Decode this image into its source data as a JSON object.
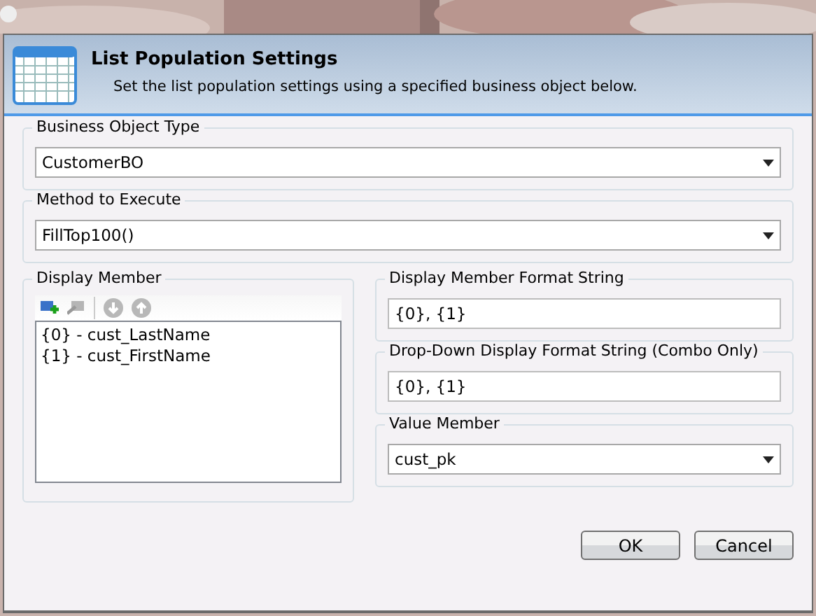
{
  "header": {
    "title": "List Population Settings",
    "subtitle": "Set the list population settings using a specified business object below."
  },
  "business_object_type": {
    "label": "Business Object Type",
    "value": "CustomerBO"
  },
  "method_to_execute": {
    "label": "Method to Execute",
    "value": "FillTop100()"
  },
  "display_member": {
    "label": "Display Member",
    "toolbar": [
      {
        "kind": "add",
        "disabled": false
      },
      {
        "kind": "remove",
        "disabled": true
      },
      {
        "kind": "separator"
      },
      {
        "kind": "down",
        "disabled": true
      },
      {
        "kind": "up",
        "disabled": true
      }
    ],
    "items": [
      "{0} - cust_LastName",
      "{1} - cust_FirstName"
    ]
  },
  "display_member_format": {
    "label": "Display Member Format String",
    "value": "{0}, {1}"
  },
  "dropdown_display_format": {
    "label": "Drop-Down Display Format String (Combo Only)",
    "value": "{0}, {1}"
  },
  "value_member": {
    "label": "Value Member",
    "value": "cust_pk"
  },
  "buttons": [
    "OK",
    "Cancel"
  ]
}
